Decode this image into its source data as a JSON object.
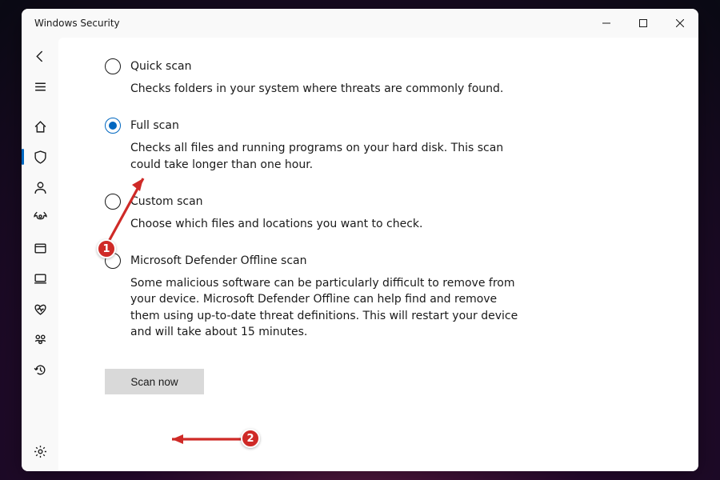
{
  "window": {
    "title": "Windows Security"
  },
  "sidebar": {
    "items": [
      {
        "name": "back"
      },
      {
        "name": "menu"
      },
      {
        "name": "home"
      },
      {
        "name": "protection",
        "active": true
      },
      {
        "name": "account"
      },
      {
        "name": "firewall"
      },
      {
        "name": "app-browser"
      },
      {
        "name": "device-security"
      },
      {
        "name": "performance"
      },
      {
        "name": "family"
      },
      {
        "name": "history"
      },
      {
        "name": "settings"
      }
    ]
  },
  "options": [
    {
      "id": "quick",
      "title": "Quick scan",
      "desc": "Checks folders in your system where threats are commonly found.",
      "selected": false
    },
    {
      "id": "full",
      "title": "Full scan",
      "desc": "Checks all files and running programs on your hard disk. This scan could take longer than one hour.",
      "selected": true
    },
    {
      "id": "custom",
      "title": "Custom scan",
      "desc": "Choose which files and locations you want to check.",
      "selected": false
    },
    {
      "id": "offline",
      "title": "Microsoft Defender Offline scan",
      "desc": "Some malicious software can be particularly difficult to remove from your device. Microsoft Defender Offline can help find and remove them using up-to-date threat definitions. This will restart your device and will take about 15 minutes.",
      "selected": false
    }
  ],
  "actions": {
    "scan_now": "Scan now"
  },
  "annotations": {
    "badge1": "1",
    "badge2": "2"
  }
}
